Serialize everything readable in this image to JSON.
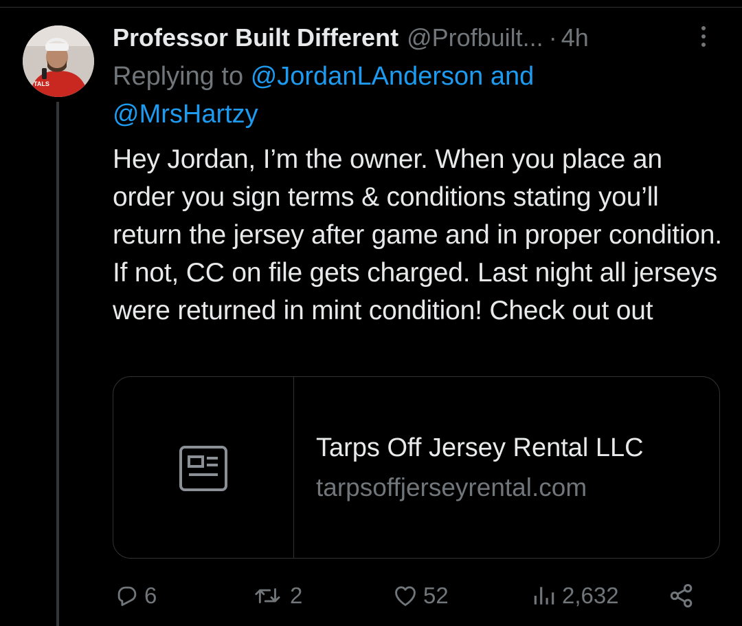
{
  "tweet": {
    "author_name": "Professor Built Different",
    "author_handle": "@Profbuilt...",
    "separator": "·",
    "time": "4h",
    "replying_prefix": "Replying to",
    "replying_user1": "@JordanLAnderson",
    "replying_and": "and",
    "replying_user2": "@MrsHartzy",
    "text": "Hey Jordan, I’m the owner. When you place an order you sign terms & conditions stating you’ll return the jersey after game and in proper condition. If not, CC on file gets charged. Last night all jerseys were returned in mint condition! Check out out",
    "avatar_shirt_text": "TALS"
  },
  "link_card": {
    "title": "Tarps Off Jersey Rental LLC",
    "domain": "tarpsoffjerseyrental.com"
  },
  "actions": {
    "replies": "6",
    "retweets": "2",
    "likes": "52",
    "views": "2,632"
  },
  "colors": {
    "background": "#000000",
    "text": "#e7e9ea",
    "muted": "#71767b",
    "link": "#1d9bf0",
    "border": "#2f3336"
  }
}
